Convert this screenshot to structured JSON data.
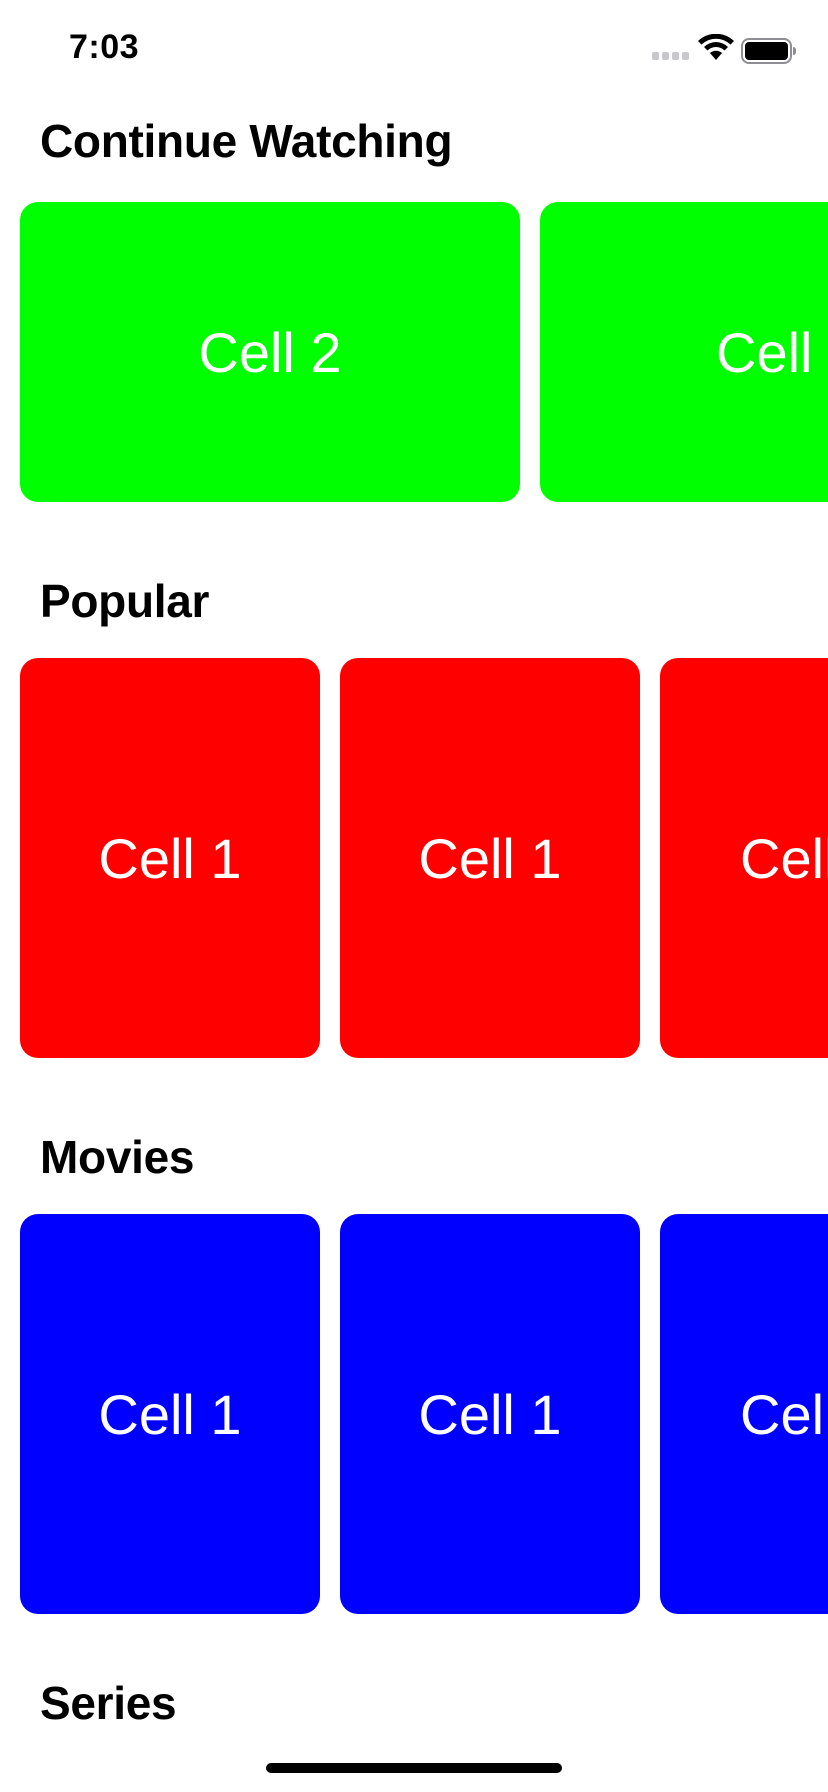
{
  "status_bar": {
    "time": "7:03",
    "icons": [
      "signal-icon",
      "wifi-icon",
      "battery-icon"
    ]
  },
  "colors": {
    "continue_watching": "#00ff00",
    "popular": "#ff0000",
    "movies": "#0000ff",
    "cell_text": "#ffffff"
  },
  "sections": [
    {
      "title": "Continue Watching",
      "cells": [
        "Cell 2",
        "Cell"
      ]
    },
    {
      "title": "Popular",
      "cells": [
        "Cell 1",
        "Cell 1",
        "Cell"
      ]
    },
    {
      "title": "Movies",
      "cells": [
        "Cell 1",
        "Cell 1",
        "Cel"
      ]
    },
    {
      "title": "Series"
    }
  ]
}
